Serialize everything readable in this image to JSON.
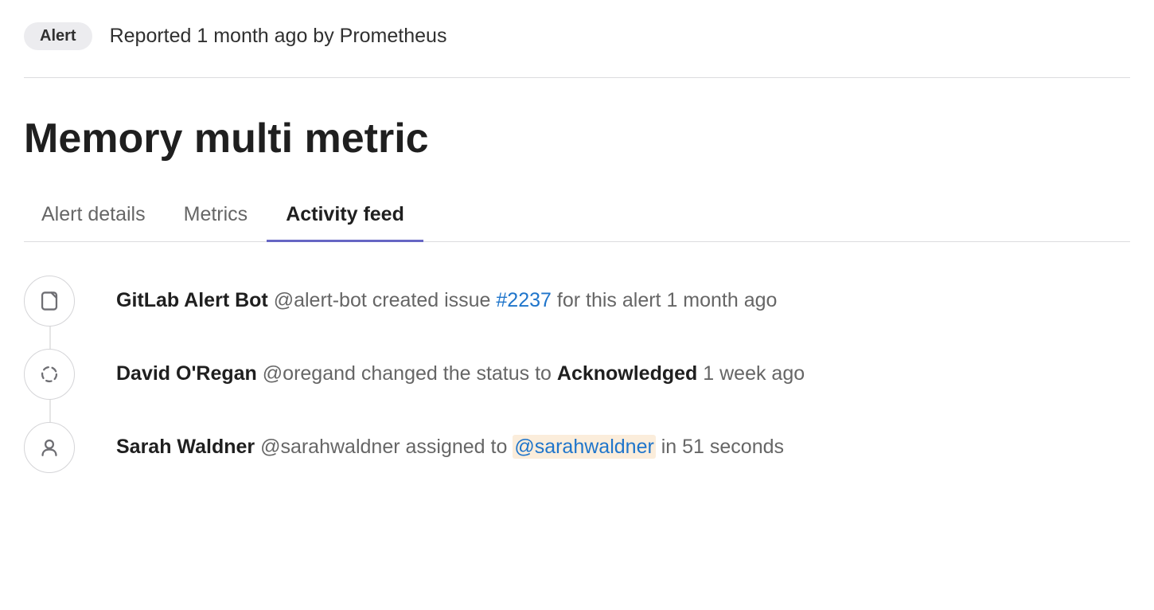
{
  "badge": "Alert",
  "reported_line": "Reported 1 month ago by Prometheus",
  "title": "Memory multi metric",
  "tabs": [
    {
      "label": "Alert details",
      "active": false
    },
    {
      "label": "Metrics",
      "active": false
    },
    {
      "label": "Activity feed",
      "active": true
    }
  ],
  "feed": [
    {
      "icon": "issue",
      "actor": "GitLab Alert Bot",
      "handle": "@alert-bot",
      "pre": "created issue",
      "link": "#2237",
      "post": "for this alert 1 month ago"
    },
    {
      "icon": "status",
      "actor": "David O'Regan",
      "handle": "@oregand",
      "pre": "changed the status to",
      "status": "Acknowledged",
      "post": "1 week ago"
    },
    {
      "icon": "user",
      "actor": "Sarah Waldner",
      "handle": "@sarahwaldner",
      "pre": "assigned to",
      "mention": "@sarahwaldner",
      "post": "in 51 seconds"
    }
  ]
}
